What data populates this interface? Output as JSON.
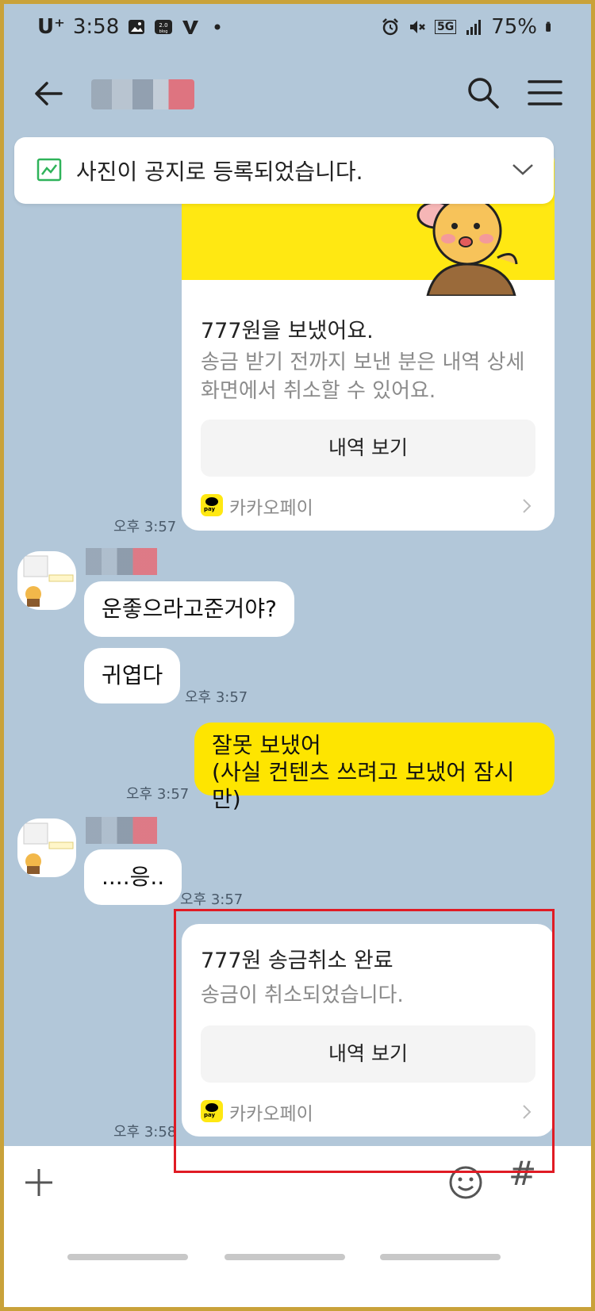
{
  "status_bar": {
    "carrier": "U⁺",
    "time": "3:58",
    "network": "5G",
    "battery": "75%"
  },
  "header": {
    "back_icon": "arrow-left-icon",
    "search_icon": "search-icon",
    "menu_icon": "hamburger-menu-icon"
  },
  "notice": {
    "text": "사진이 공지로 등록되었습니다."
  },
  "messages": {
    "pay_sent": {
      "title": "777원을 보냈어요.",
      "description": "송금 받기 전까지 보낸 분은 내역 상세 화면에서 취소할 수 있어요.",
      "button": "내역 보기",
      "brand": "카카오페이",
      "pay_badge": "pay",
      "time": "오후 3:57"
    },
    "friend_1": {
      "bubble_1": "운좋으라고준거야?",
      "bubble_2": "귀엽다",
      "time": "오후 3:57"
    },
    "me_1": {
      "line_1": "잘못 보냈어",
      "line_2": "(사실 컨텐츠 쓰려고 보냈어 잠시만)",
      "time": "오후 3:57"
    },
    "friend_2": {
      "bubble_1": "....응..",
      "time": "오후 3:57"
    },
    "pay_cancel": {
      "title": "777원 송금취소 완료",
      "description": "송금이 취소되었습니다.",
      "button": "내역 보기",
      "brand": "카카오페이",
      "pay_badge": "pay",
      "time": "오후 3:58"
    }
  },
  "input_bar": {
    "hash": "#"
  },
  "colors": {
    "chat_background": "#b2c7d9",
    "my_bubble": "#fee500",
    "highlight_border": "#e01b24"
  }
}
